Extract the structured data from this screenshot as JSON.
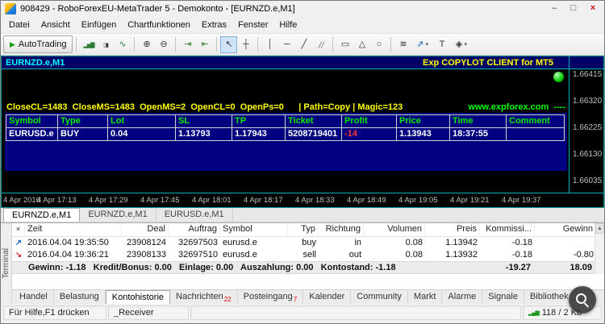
{
  "window": {
    "title": "908429 - RoboForexEU-MetaTrader 5 - Demokonto - [EURNZD.e,M1]",
    "controls": {
      "minimize": "–",
      "maximize": "□",
      "close": "×"
    }
  },
  "menu": {
    "items": [
      "Datei",
      "Ansicht",
      "Einfügen",
      "Chartfunktionen",
      "Extras",
      "Fenster",
      "Hilfe"
    ]
  },
  "toolbar": {
    "autotrading": {
      "label": "AutoTrading",
      "glyph": "▶"
    },
    "icons": {
      "bars": "▂▅▇",
      "candles": "▯▮",
      "line_chart": "∿",
      "zoom_in": "⊕",
      "zoom_out": "⊖",
      "auto_scroll": "⇥",
      "chart_shift": "⇤",
      "cursor": "↖",
      "crosshair": "┼",
      "vertical_line": "│",
      "horizontal_line": "─",
      "trendline": "╱",
      "channel": "╱╱",
      "rectangle": "▭",
      "triangle": "△",
      "ellipse": "○",
      "fibonacci": "≋",
      "arrows": "⇗",
      "text": "T",
      "indicators": "◈",
      "dropdown": "▾"
    }
  },
  "chart": {
    "symbol_label": "EURNZD.e,M1",
    "ea_label": "Exp COPYLOT CLIENT for MT5",
    "info_line": "CloseCL=1483  CloseMS=1483  OpenMS=2  OpenCL=0  OpenPs=0      | Path=Copy | Magic=123",
    "website": "www.expforex.com  ----",
    "positions_table": {
      "headers": [
        "Symbol",
        "Type",
        "Lot",
        "SL",
        "TP",
        "Ticket",
        "Profit",
        "Price",
        "Time",
        "Comment"
      ],
      "row": {
        "symbol": "EURUSD.e",
        "type": "BUY",
        "lot": "0.04",
        "sl": "1.13793",
        "tp": "1.17943",
        "ticket": "5208719401",
        "profit": "-14",
        "price": "1.13943",
        "time": "18:37:55",
        "comment": ""
      }
    },
    "price_scale": [
      "1.66415",
      "1.66320",
      "1.66225",
      "1.66130",
      "1.66035"
    ],
    "time_axis": [
      "4 Apr 2016",
      "4 Apr 17:13",
      "4 Apr 17:29",
      "4 Apr 17:45",
      "4 Apr 18:01",
      "4 Apr 18:17",
      "4 Apr 18:33",
      "4 Apr 18:49",
      "4 Apr 19:05",
      "4 Apr 19:21",
      "4 Apr 19:37"
    ]
  },
  "chart_tabs": [
    {
      "label": "EURNZD.e,M1"
    },
    {
      "label": "EURNZD.e,M1"
    },
    {
      "label": "EURUSD.e,M1"
    }
  ],
  "terminal": {
    "side_label": "Terminal",
    "icons": {
      "close": "×",
      "scroll_up": "▲"
    },
    "columns": [
      "Zeit",
      "Deal",
      "Auftrag",
      "Symbol",
      "Typ",
      "Richtung",
      "Volumen",
      "Preis",
      "Kommissi...",
      "Gewinn"
    ],
    "rows": [
      {
        "icon": "↗",
        "zeit": "2016.04.04 19:35:50",
        "deal": "23908124",
        "auftrag": "32697503",
        "symbol": "eurusd.e",
        "typ": "buy",
        "richtung": "in",
        "volumen": "0.08",
        "preis": "1.13942",
        "kommission": "-0.18",
        "gewinn": ""
      },
      {
        "icon": "↘",
        "zeit": "2016.04.04 19:36:21",
        "deal": "23908133",
        "auftrag": "32697510",
        "symbol": "eurusd.e",
        "typ": "sell",
        "richtung": "out",
        "volumen": "0.08",
        "preis": "1.13932",
        "kommission": "-0.18",
        "gewinn": "-0.80"
      }
    ],
    "summary": {
      "text": "Gewinn: -1.18   Kredit/Bonus: 0.00   Einlage: 0.00   Auszahlung: 0.00   Kontostand: -1.18",
      "kommission_total": "-19.27",
      "gewinn_total": "18.09"
    },
    "tabs": [
      {
        "label": "Handel"
      },
      {
        "label": "Belastung"
      },
      {
        "label": "Kontohistorie"
      },
      {
        "label": "Nachrichten",
        "badge": "22"
      },
      {
        "label": "Posteingang",
        "badge": "7"
      },
      {
        "label": "Kalender"
      },
      {
        "label": "Community"
      },
      {
        "label": "Markt"
      },
      {
        "label": "Alarme"
      },
      {
        "label": "Signale"
      },
      {
        "label": "Bibliothek"
      }
    ]
  },
  "statusbar": {
    "help": "Für Hilfe,F1 drücken",
    "receiver": "_Receiver",
    "connection_glyph": "▂▄▆",
    "traffic": "118 / 2 Kb"
  },
  "colors": {
    "panel_navy": "#000080",
    "accent_cyan": "#00FFFF",
    "accent_yellow": "#FFFF00",
    "accent_green": "#00FF00",
    "loss_red": "#FF3333"
  }
}
